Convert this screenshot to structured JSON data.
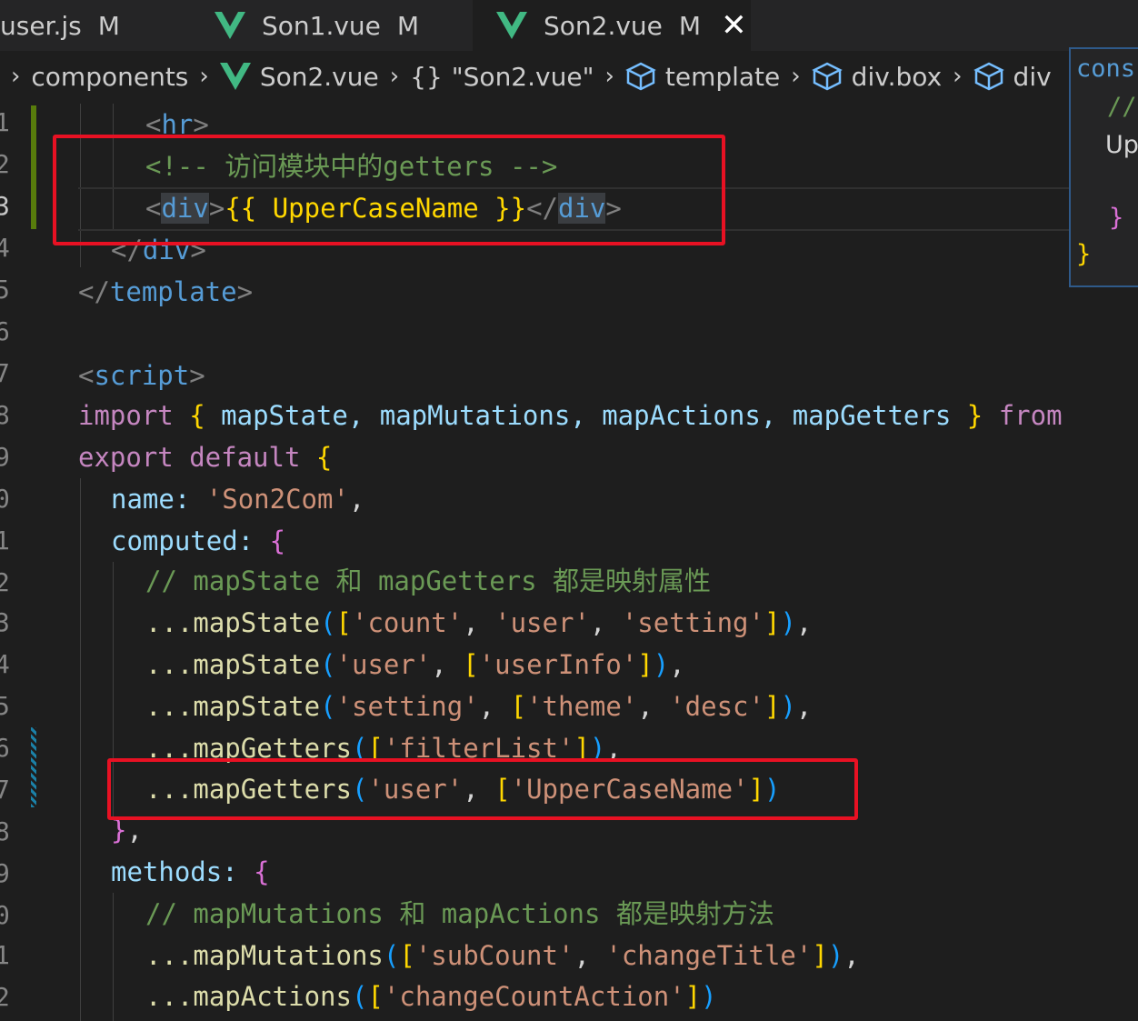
{
  "tabs": [
    {
      "label": "user.js",
      "status": "M"
    },
    {
      "label": "Son1.vue",
      "status": "M"
    },
    {
      "label": "Son2.vue",
      "status": "M",
      "active": true
    }
  ],
  "breadcrumb": {
    "items": [
      "components",
      "Son2.vue",
      "\"Son2.vue\"",
      "template",
      "div.box",
      "div"
    ]
  },
  "line_numbers": [
    "1",
    "2",
    "3",
    "4",
    "5",
    "6",
    "7",
    "8",
    "9",
    "0",
    "1",
    "2",
    "3",
    "4",
    "5",
    "6",
    "7",
    "8",
    "9",
    "0",
    "1",
    "2"
  ],
  "current_line_index": 2,
  "code": {
    "l1_tag": "hr",
    "l2_comment": "<!-- 访问模块中的getters -->",
    "l3_mustache": "{{ UpperCaseName }}",
    "l3_tag": "div",
    "l4_tag": "div",
    "l5_tag": "template",
    "l7_tag": "script",
    "l8_import": "import",
    "l8_names": "mapState, mapMutations, mapActions, mapGetters",
    "l8_from": "from",
    "l9_export": "export default",
    "l10_key": "name:",
    "l10_val": "'Son2Com'",
    "l11_key": "computed:",
    "l12_comment": "// mapState 和 mapGetters 都是映射属性",
    "l13_fn": "...mapState",
    "l13_args": [
      "'count'",
      "'user'",
      "'setting'"
    ],
    "l14_fn": "...mapState",
    "l14_ns": "'user'",
    "l14_args": [
      "'userInfo'"
    ],
    "l15_fn": "...mapState",
    "l15_ns": "'setting'",
    "l15_args": [
      "'theme'",
      "'desc'"
    ],
    "l16_fn": "...mapGetters",
    "l16_args": [
      "'filterList'"
    ],
    "l17_fn": "...mapGetters",
    "l17_ns": "'user'",
    "l17_args": [
      "'UpperCaseName'"
    ],
    "l19_key": "methods:",
    "l20_comment": "// mapMutations 和 mapActions 都是映射方法",
    "l21_fn": "...mapMutations",
    "l21_args": [
      "'subCount'",
      "'changeTitle'"
    ],
    "l22_fn": "...mapActions",
    "l22_args": [
      "'changeCountAction'"
    ]
  },
  "hover_panel": {
    "line1": "cons",
    "line2": "//",
    "line3": "Up"
  },
  "colors": {
    "highlight_box": "#e81123",
    "keyword": "#c586c0",
    "string": "#ce9178",
    "variable": "#9cdcfe",
    "function": "#dcdcaa",
    "comment": "#6a9955"
  }
}
